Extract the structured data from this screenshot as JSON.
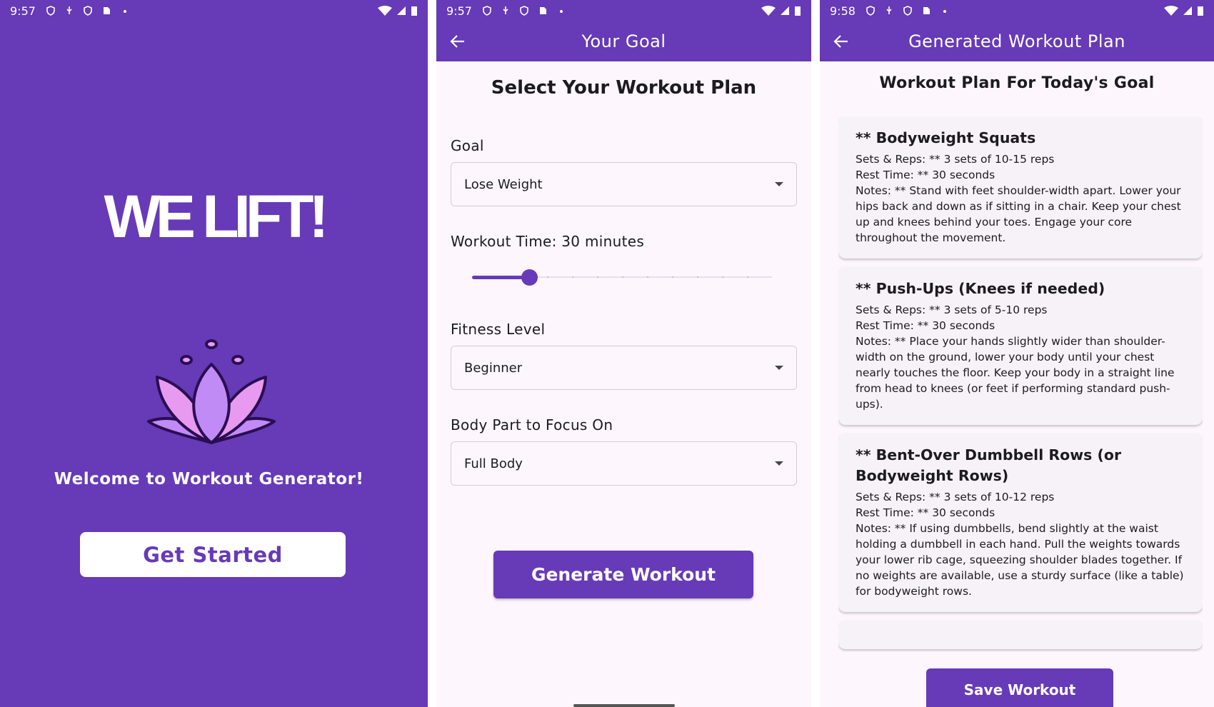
{
  "colors": {
    "primary": "#673ab7",
    "surface": "#fdf7fd",
    "lotus_light": "#e89af0",
    "lotus_mid": "#c18bf5",
    "lotus_outline": "#2a0e52"
  },
  "screen1": {
    "status_time": "9:57",
    "logo": "WE LIFT!",
    "welcome": "Welcome to Workout Generator!",
    "get_started_label": "Get Started"
  },
  "screen2": {
    "status_time": "9:57",
    "title": "Your Goal",
    "heading": "Select Your Workout Plan",
    "goal_label": "Goal",
    "goal_value": "Lose Weight",
    "time_label": "Workout Time: 30 minutes",
    "slider_fraction": 0.19,
    "fitness_label": "Fitness Level",
    "fitness_value": "Beginner",
    "body_label": "Body Part to Focus On",
    "body_value": "Full Body",
    "generate_label": "Generate Workout"
  },
  "screen3": {
    "status_time": "9:58",
    "title": "Generated Workout Plan",
    "heading": "Workout Plan For Today's Goal",
    "cards": [
      {
        "title": "** Bodyweight Squats",
        "sets": "Sets & Reps: ** 3 sets of 10-15 reps",
        "rest": "Rest Time: ** 30 seconds",
        "notes": "Notes: ** Stand with feet shoulder-width apart. Lower your hips back and down as if sitting in a chair. Keep your chest up and knees behind your toes. Engage your core throughout the movement."
      },
      {
        "title": "** Push-Ups (Knees if needed)",
        "sets": "Sets & Reps: ** 3 sets of 5-10 reps",
        "rest": "Rest Time: ** 30 seconds",
        "notes": "Notes: ** Place your hands slightly wider than shoulder-width on the ground, lower your body until your chest nearly touches the floor. Keep your body in a straight line from head to knees (or feet if performing standard push-ups)."
      },
      {
        "title": "** Bent-Over Dumbbell Rows (or Bodyweight Rows)",
        "sets": "Sets & Reps: ** 3 sets of 10-12 reps",
        "rest": "Rest Time: ** 30 seconds",
        "notes": "Notes: ** If using dumbbells, bend slightly at the waist holding a dumbbell in each hand. Pull the weights towards your lower rib cage, squeezing shoulder blades together. If no weights are available, use a sturdy surface (like a table) for bodyweight rows."
      }
    ],
    "save_label": "Save Workout"
  },
  "icons": {
    "back": "arrow-left-icon",
    "dropdown": "caret-down-icon",
    "logo": "lotus-icon",
    "status": [
      "shield-icon",
      "usb-icon",
      "sim-icon",
      "wifi-icon",
      "signal-icon",
      "battery-icon"
    ]
  }
}
